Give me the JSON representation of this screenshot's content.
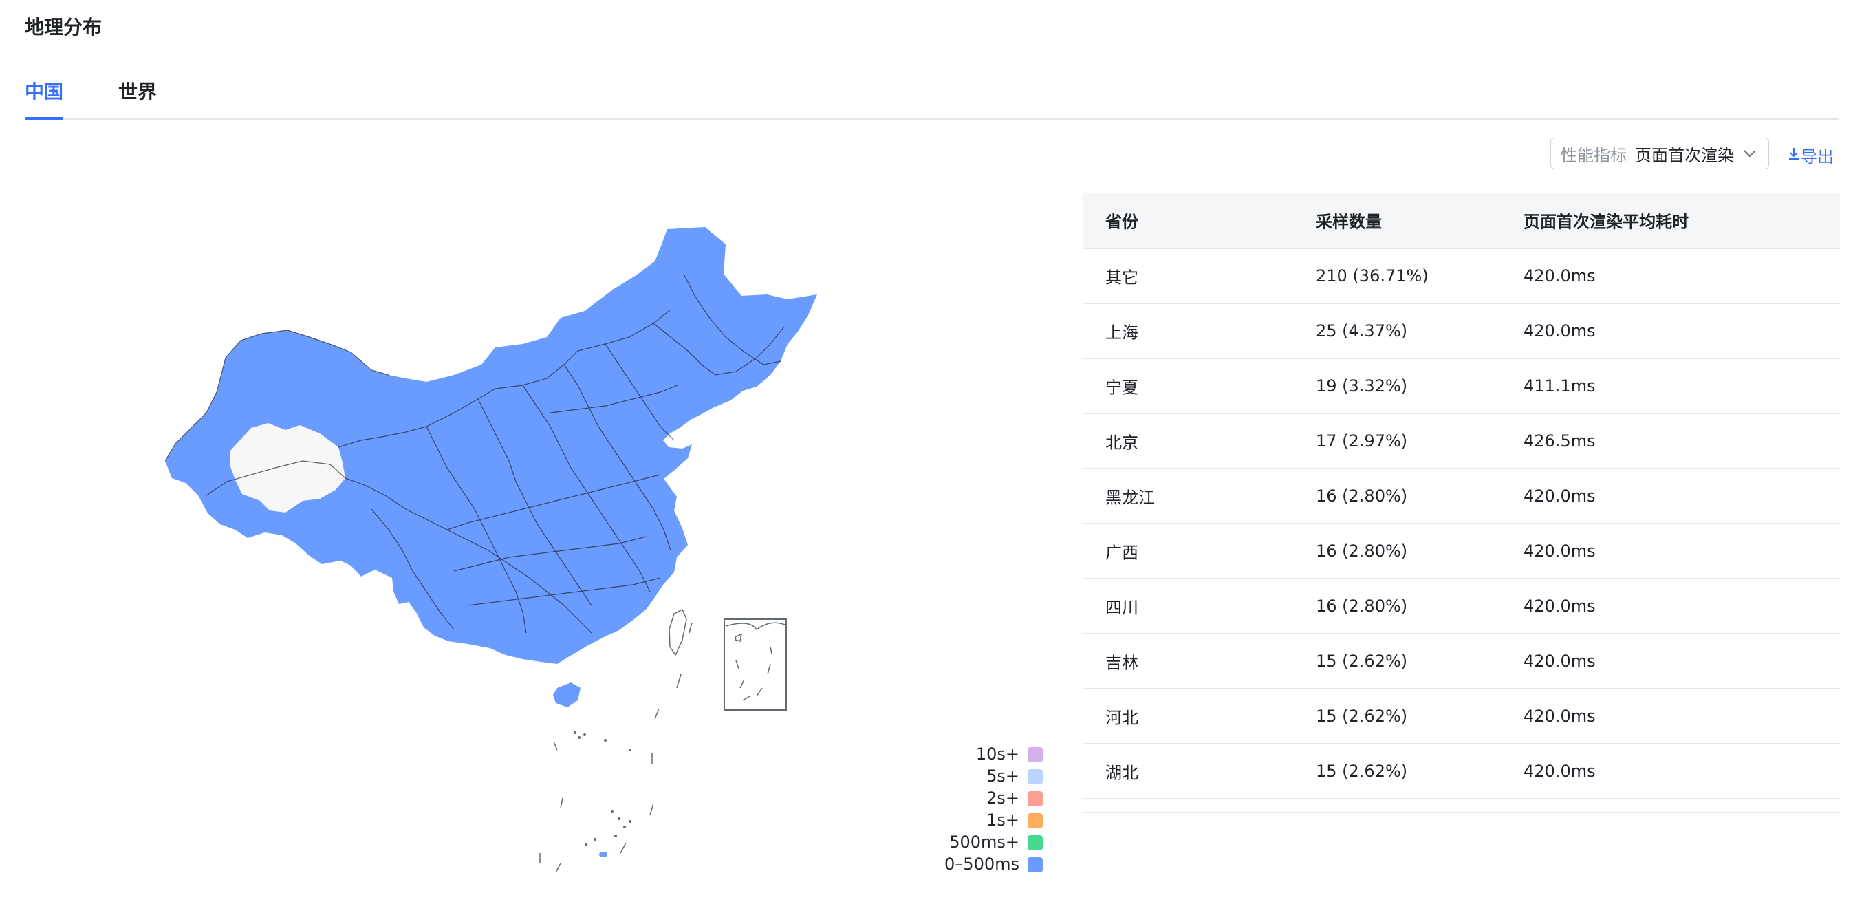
{
  "section": {
    "title": "地理分布"
  },
  "tabs": [
    {
      "label": "中国"
    },
    {
      "label": "世界"
    }
  ],
  "toolbar": {
    "metric_label": "性能指标",
    "metric_value": "页面首次渲染",
    "export_label": "导出"
  },
  "legend": [
    {
      "label": "10s+",
      "color": "#d4b0ed"
    },
    {
      "label": "5s+",
      "color": "#b9d5ff"
    },
    {
      "label": "2s+",
      "color": "#fb9f94"
    },
    {
      "label": "1s+",
      "color": "#ffac5c"
    },
    {
      "label": "500ms+",
      "color": "#46d98f"
    },
    {
      "label": "0–500ms",
      "color": "#6a9bff"
    }
  ],
  "map": {
    "fill_color": "#6a9bff",
    "no_data_color": "#f7f7f7",
    "no_data_region": "青海"
  },
  "table": {
    "headers": {
      "province": "省份",
      "samples": "采样数量",
      "avg_time": "页面首次渲染平均耗时"
    },
    "rows": [
      {
        "province": "其它",
        "samples": "210 (36.71%)",
        "avg_time": "420.0ms"
      },
      {
        "province": "上海",
        "samples": "25 (4.37%)",
        "avg_time": "420.0ms"
      },
      {
        "province": "宁夏",
        "samples": "19 (3.32%)",
        "avg_time": "411.1ms"
      },
      {
        "province": "北京",
        "samples": "17 (2.97%)",
        "avg_time": "426.5ms"
      },
      {
        "province": "黑龙江",
        "samples": "16 (2.80%)",
        "avg_time": "420.0ms"
      },
      {
        "province": "广西",
        "samples": "16 (2.80%)",
        "avg_time": "420.0ms"
      },
      {
        "province": "四川",
        "samples": "16 (2.80%)",
        "avg_time": "420.0ms"
      },
      {
        "province": "吉林",
        "samples": "15 (2.62%)",
        "avg_time": "420.0ms"
      },
      {
        "province": "河北",
        "samples": "15 (2.62%)",
        "avg_time": "420.0ms"
      },
      {
        "province": "湖北",
        "samples": "15 (2.62%)",
        "avg_time": "420.0ms"
      }
    ]
  }
}
